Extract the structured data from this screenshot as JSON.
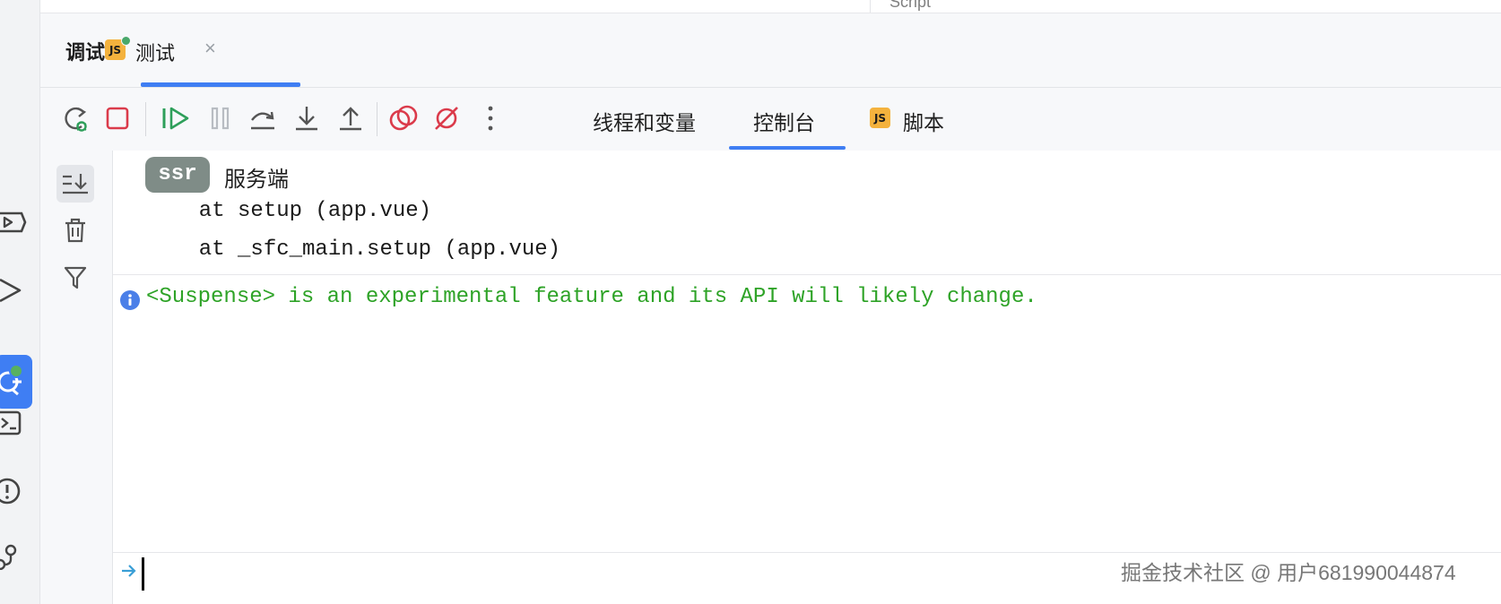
{
  "colors": {
    "accent": "#3f7ef3",
    "success_text": "#2ea327",
    "ssr_badge": "#7f8c87",
    "js_badge": "#f4b23d",
    "stop_red": "#db3b4b",
    "resume_green": "#2e9f5a"
  },
  "top_remnant": {
    "text": "Script"
  },
  "debug_window": {
    "title": "调试",
    "session_tab": {
      "icon": "js-file-icon",
      "label": "测试",
      "close": "×"
    }
  },
  "toolbar": {
    "buttons": [
      {
        "name": "rerun-debug",
        "icon": "rerun-debug-icon"
      },
      {
        "name": "stop",
        "icon": "stop-icon"
      },
      {
        "name": "resume",
        "icon": "resume-icon"
      },
      {
        "name": "pause",
        "icon": "pause-icon"
      },
      {
        "name": "step-over",
        "icon": "step-over-icon"
      },
      {
        "name": "step-into",
        "icon": "step-into-icon"
      },
      {
        "name": "step-out",
        "icon": "step-out-icon"
      },
      {
        "name": "view-breakpoints",
        "icon": "view-breakpoints-icon"
      },
      {
        "name": "mute-breakpoints",
        "icon": "mute-breakpoints-icon"
      },
      {
        "name": "more",
        "icon": "more-vertical-icon"
      }
    ],
    "tabs": [
      {
        "label": "线程和变量",
        "active": false
      },
      {
        "label": "控制台",
        "active": true
      },
      {
        "label": "脚本",
        "active": false,
        "icon": "js-file-icon"
      }
    ]
  },
  "console": {
    "gutter": [
      {
        "name": "scroll-to-end",
        "icon": "scroll-to-end-icon"
      },
      {
        "name": "clear-all",
        "icon": "trash-icon"
      },
      {
        "name": "filter",
        "icon": "filter-icon"
      }
    ],
    "log": {
      "badge": "ssr",
      "source": "服务端",
      "stack": [
        "  at setup (app.vue)",
        "  at _sfc_main.setup (app.vue)"
      ]
    },
    "info_message": "<Suspense> is an experimental feature and its API will likely change.",
    "input": {
      "value": "",
      "prompt_icon": "prompt-arrow-icon"
    }
  },
  "left_strip": {
    "icons": [
      "run-dashboard-icon",
      "run-icon",
      "debug-icon",
      "terminal-icon",
      "problems-icon",
      "git-icon"
    ],
    "active": "debug-icon"
  },
  "watermark": "掘金技术社区 @ 用户681990044874"
}
